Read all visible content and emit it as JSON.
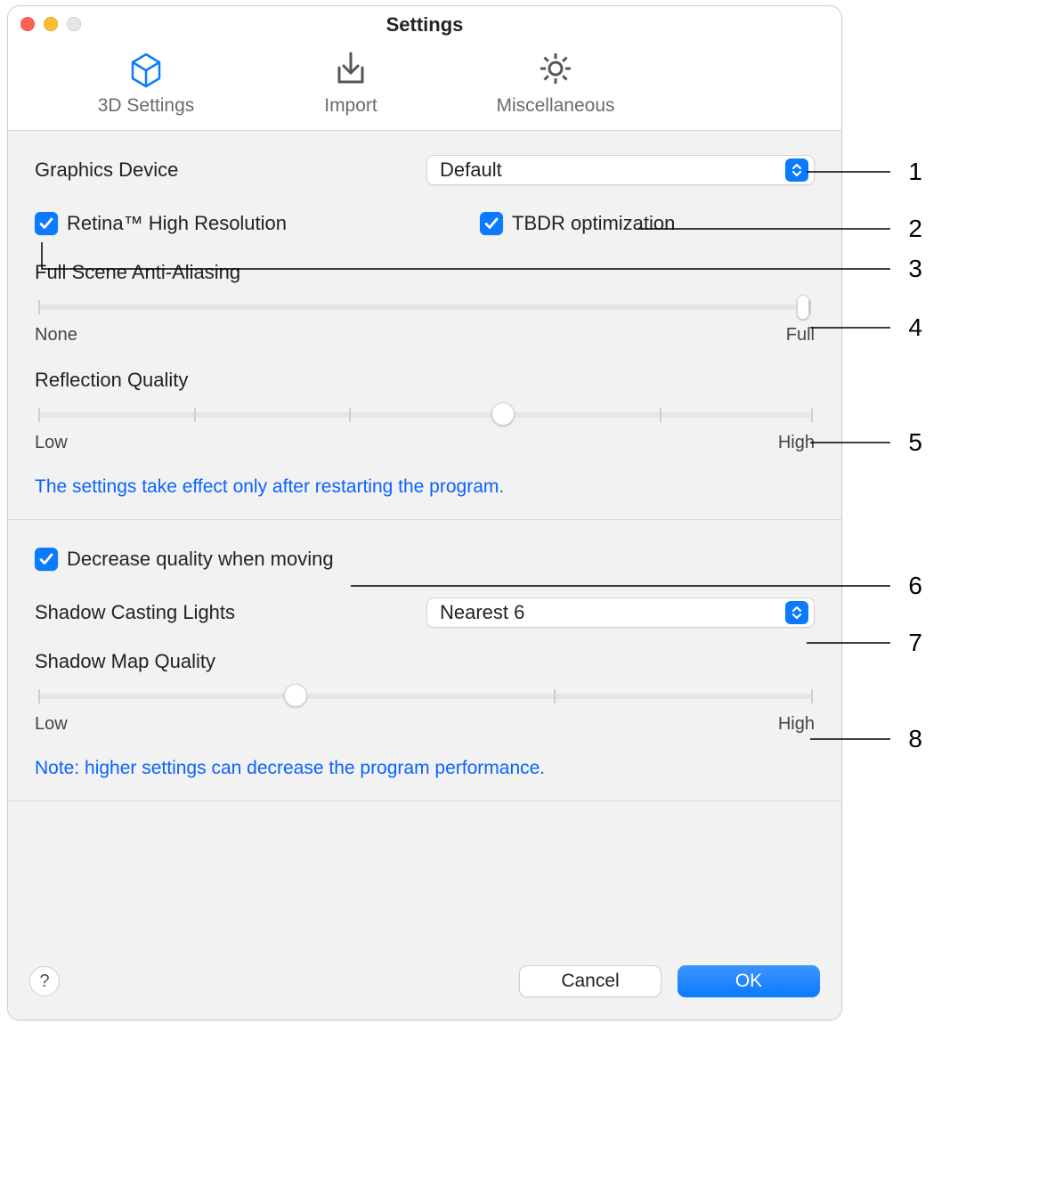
{
  "window": {
    "title": "Settings"
  },
  "toolbar": {
    "tabs": [
      {
        "label": "3D Settings",
        "active": true,
        "icon": "cube-icon"
      },
      {
        "label": "Import",
        "active": false,
        "icon": "download-box-icon"
      },
      {
        "label": "Miscellaneous",
        "active": false,
        "icon": "gear-icon"
      }
    ]
  },
  "section1": {
    "graphics_device_label": "Graphics Device",
    "graphics_device_value": "Default",
    "retina_label": "Retina™ High Resolution",
    "retina_checked": true,
    "tbdr_label": "TBDR optimization",
    "tbdr_checked": true,
    "fsaa_label": "Full Scene Anti-Aliasing",
    "fsaa_min_label": "None",
    "fsaa_max_label": "Full",
    "fsaa_value_pct": 100,
    "reflection_label": "Reflection Quality",
    "reflection_min_label": "Low",
    "reflection_max_label": "High",
    "reflection_ticks": 6,
    "reflection_value_pct": 60,
    "restart_note": "The settings take effect only after restarting the program."
  },
  "section2": {
    "decrease_label": "Decrease quality when moving",
    "decrease_checked": true,
    "shadow_lights_label": "Shadow Casting Lights",
    "shadow_lights_value": "Nearest 6",
    "shadow_map_label": "Shadow Map Quality",
    "shadow_map_min_label": "Low",
    "shadow_map_max_label": "High",
    "shadow_map_ticks": 4,
    "shadow_map_value_pct": 33,
    "perf_note": "Note: higher settings can decrease the program performance."
  },
  "footer": {
    "help_symbol": "?",
    "cancel_label": "Cancel",
    "ok_label": "OK"
  },
  "callouts": {
    "n1": "1",
    "n2": "2",
    "n3": "3",
    "n4": "4",
    "n5": "5",
    "n6": "6",
    "n7": "7",
    "n8": "8"
  }
}
